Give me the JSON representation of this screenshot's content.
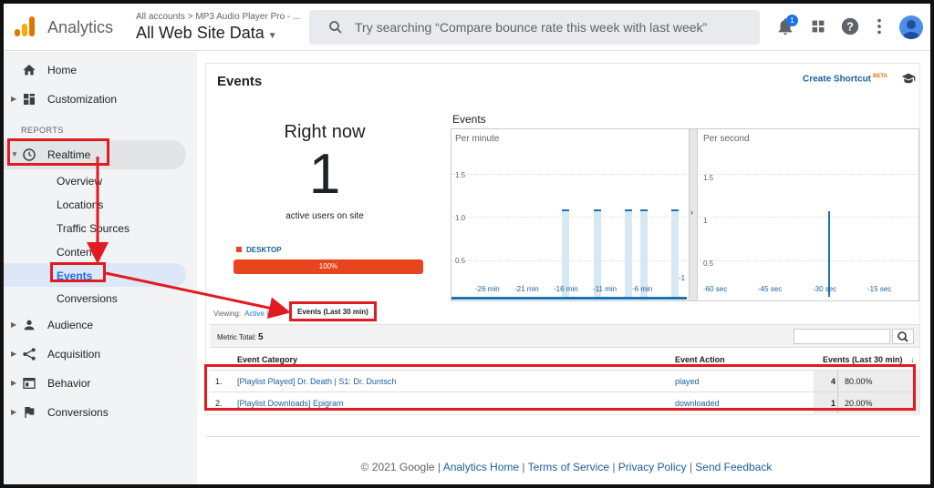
{
  "header": {
    "app_name": "Analytics",
    "account_path": "All accounts > MP3 Audio Player Pro - ...",
    "view_name": "All Web Site Data",
    "search_placeholder": "Try searching “Compare bounce rate this week with last week”",
    "notification_count": "1"
  },
  "sidebar": {
    "home": "Home",
    "customization": "Customization",
    "reports_header": "REPORTS",
    "realtime": "Realtime",
    "realtime_sub": [
      "Overview",
      "Locations",
      "Traffic Sources",
      "Content",
      "Events",
      "Conversions"
    ],
    "audience": "Audience",
    "acquisition": "Acquisition",
    "behavior": "Behavior",
    "conversions": "Conversions"
  },
  "report": {
    "title": "Events",
    "create_shortcut": "Create Shortcut",
    "beta": "BETA",
    "right_now": "Right now",
    "active_users": "1",
    "active_label": "active users on site",
    "device_label": "DESKTOP",
    "device_pct": "100%",
    "device_fraction": 1.0,
    "chart_title": "Events",
    "per_minute_label": "Per minute",
    "per_second_label": "Per second",
    "per_minute_y_ticks": [
      "1.5",
      "1.0",
      "0.5"
    ],
    "per_second_y_ticks": [
      "1.5",
      "1",
      "0.5"
    ],
    "per_minute_x_ticks": [
      "-26 min",
      "-21 min",
      "-16 min",
      "-11 min",
      "-6 min",
      "-1"
    ],
    "per_second_x_ticks": [
      "-60 sec",
      "-45 sec",
      "-30 sec",
      "-15 sec"
    ],
    "viewing_label": "Viewing:",
    "active_tab": "Active U...",
    "last30_tab": "Events (Last 30 min)",
    "metric_total_label": "Metric Total:",
    "metric_total": "5",
    "columns": [
      "Event Category",
      "Event Action",
      "Events (Last 30 min)"
    ],
    "rows": [
      {
        "num": "1.",
        "category": "[Playlist Played] Dr. Death | S1: Dr. Duntsch",
        "action": "played",
        "count": "4",
        "pct": "80.00%"
      },
      {
        "num": "2.",
        "category": "[Playlist Downloads] Epigram",
        "action": "downloaded",
        "count": "1",
        "pct": "20.00%"
      }
    ]
  },
  "footer": {
    "copyright": "© 2021 Google",
    "links": [
      "Analytics Home",
      "Terms of Service",
      "Privacy Policy",
      "Send Feedback"
    ]
  },
  "colors": {
    "accent_blue": "#1a73e8",
    "link_blue": "#1a5f9e",
    "device_orange": "#e8451f",
    "annotation_red": "#e11b22"
  }
}
